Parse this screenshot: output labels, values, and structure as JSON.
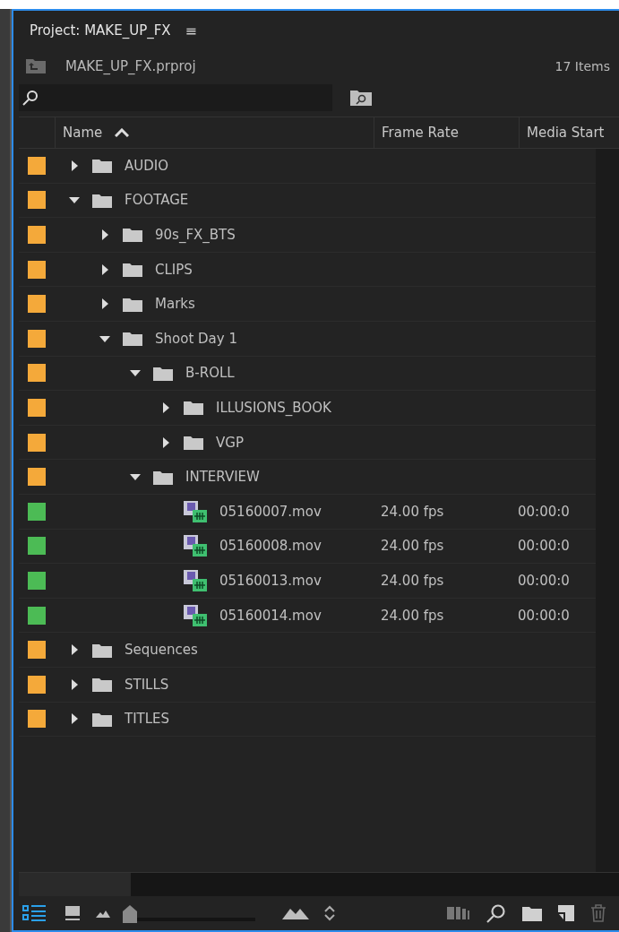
{
  "panel": {
    "title": "Project: MAKE_UP_FX",
    "menu_glyph": "≡",
    "file_name": "MAKE_UP_FX.prproj",
    "item_count": "17 Items"
  },
  "columns": [
    {
      "label": "Name",
      "sorted": true
    },
    {
      "label": "Frame Rate",
      "sorted": false
    },
    {
      "label": "Media Start",
      "sorted": false
    }
  ],
  "items": [
    {
      "kind": "folder",
      "name": "AUDIO",
      "color": "#f4a93a",
      "expanded": false
    },
    {
      "kind": "folder",
      "name": "FOOTAGE",
      "color": "#f4a93a",
      "expanded": true,
      "children": [
        {
          "kind": "folder",
          "name": "90s_FX_BTS",
          "color": "#f4a93a",
          "expanded": false
        },
        {
          "kind": "folder",
          "name": "CLIPS",
          "color": "#f4a93a",
          "expanded": false
        },
        {
          "kind": "folder",
          "name": "Marks",
          "color": "#f4a93a",
          "expanded": false
        },
        {
          "kind": "folder",
          "name": "Shoot Day 1",
          "color": "#f4a93a",
          "expanded": true,
          "children": [
            {
              "kind": "folder",
              "name": "B-ROLL",
              "color": "#f4a93a",
              "expanded": true,
              "children": [
                {
                  "kind": "folder",
                  "name": "ILLUSIONS_BOOK",
                  "color": "#f4a93a",
                  "expanded": false
                },
                {
                  "kind": "folder",
                  "name": "VGP",
                  "color": "#f4a93a",
                  "expanded": false
                }
              ]
            },
            {
              "kind": "folder",
              "name": "INTERVIEW",
              "color": "#f4a93a",
              "expanded": true,
              "children": [
                {
                  "kind": "clip",
                  "name": "05160007.mov",
                  "color": "#4cbb55",
                  "frame_rate": "24.00 fps",
                  "media_start": "00:00:0"
                },
                {
                  "kind": "clip",
                  "name": "05160008.mov",
                  "color": "#4cbb55",
                  "frame_rate": "24.00 fps",
                  "media_start": "00:00:0"
                },
                {
                  "kind": "clip",
                  "name": "05160013.mov",
                  "color": "#4cbb55",
                  "frame_rate": "24.00 fps",
                  "media_start": "00:00:0"
                },
                {
                  "kind": "clip",
                  "name": "05160014.mov",
                  "color": "#4cbb55",
                  "frame_rate": "24.00 fps",
                  "media_start": "00:00:0"
                }
              ]
            }
          ]
        }
      ]
    },
    {
      "kind": "folder",
      "name": "Sequences",
      "color": "#f4a93a",
      "expanded": false
    },
    {
      "kind": "folder",
      "name": "STILLS",
      "color": "#f4a93a",
      "expanded": false
    },
    {
      "kind": "folder",
      "name": "TITLES",
      "color": "#f4a93a",
      "expanded": false
    }
  ],
  "toolbar": {
    "list_view_selected": true,
    "zoom": {
      "level": 0.0
    }
  }
}
